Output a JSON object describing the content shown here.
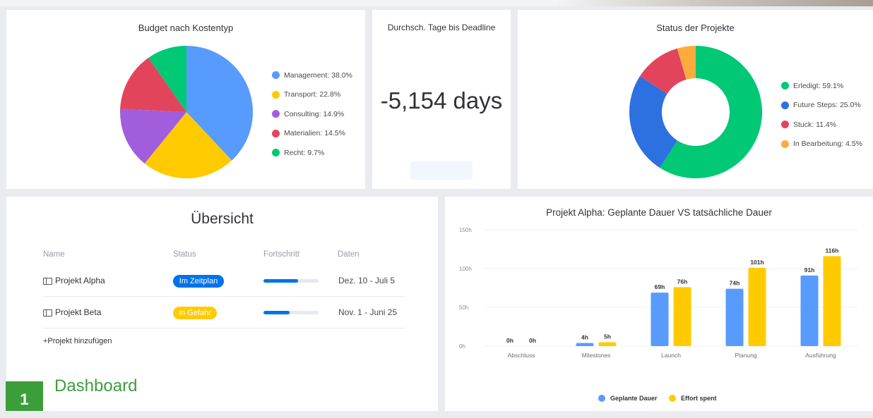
{
  "budget": {
    "title": "Budget nach Kostentyp",
    "legend": [
      {
        "label": "Management: 38.0%",
        "color": "#579bfc"
      },
      {
        "label": "Transport: 22.8%",
        "color": "#ffcb00"
      },
      {
        "label": "Consulting: 14.9%",
        "color": "#a25ddc"
      },
      {
        "label": "Materialien: 14.5%",
        "color": "#e2445c"
      },
      {
        "label": "Recht: 9.7%",
        "color": "#00c875"
      }
    ]
  },
  "deadline": {
    "title": "Durchsch. Tage bis Deadline",
    "value": "-5,154 days"
  },
  "status": {
    "title": "Status der Projekte",
    "legend": [
      {
        "label": "Erledigt: 59.1%",
        "color": "#00c875"
      },
      {
        "label": "Future Steps: 25.0%",
        "color": "#2d70e0"
      },
      {
        "label": "Stuck: 11.4%",
        "color": "#e2445c"
      },
      {
        "label": "In Bearbeitung: 4.5%",
        "color": "#fdab3d"
      }
    ]
  },
  "overview": {
    "title": "Übersicht",
    "columns": [
      "Name",
      "Status",
      "Fortschritt",
      "Daten"
    ],
    "rows": [
      {
        "name": "Projekt Alpha",
        "status": "Im Zeitplan",
        "status_color": "#0073ea",
        "progress": 0.63,
        "dates": "Dez. 10 - Juli 5"
      },
      {
        "name": "Projekt Beta",
        "status": "In Gefahr",
        "status_color": "#ffcb00",
        "progress": 0.47,
        "dates": "Nov. 1 - Juni 25"
      }
    ],
    "add_label": "+Projekt hinzufügen"
  },
  "chart_data": [
    {
      "type": "pie",
      "title": "Budget nach Kostentyp",
      "categories": [
        "Management",
        "Transport",
        "Consulting",
        "Materialien",
        "Recht"
      ],
      "values": [
        38.0,
        22.8,
        14.9,
        14.5,
        9.7
      ],
      "colors": [
        "#579bfc",
        "#ffcb00",
        "#a25ddc",
        "#e2445c",
        "#00c875"
      ]
    },
    {
      "type": "pie",
      "title": "Status der Projekte",
      "donut": true,
      "categories": [
        "Erledigt",
        "Future Steps",
        "Stuck",
        "In Bearbeitung"
      ],
      "values": [
        59.1,
        25.0,
        11.4,
        4.5
      ],
      "colors": [
        "#00c875",
        "#2d70e0",
        "#e2445c",
        "#fdab3d"
      ]
    },
    {
      "type": "bar",
      "title": "Projekt Alpha: Geplante Dauer VS tatsächliche Dauer",
      "categories": [
        "Abschluss",
        "Milestones",
        "Launch",
        "Planung",
        "Ausführung"
      ],
      "series": [
        {
          "name": "Geplante Dauer",
          "color": "#579bfc",
          "values": [
            0,
            4,
            69,
            74,
            91
          ],
          "labels": [
            "0h",
            "4h",
            "69h",
            "74h",
            "91h"
          ]
        },
        {
          "name": "Effort spent",
          "color": "#ffcb00",
          "values": [
            0,
            5,
            76,
            101,
            116
          ],
          "labels": [
            "0h",
            "5h",
            "76h",
            "101h",
            "116h"
          ]
        }
      ],
      "yticks": [
        "0h",
        "50h",
        "100h",
        "150h"
      ],
      "ylim": [
        0,
        150
      ],
      "grid": true,
      "legend_position": "bottom"
    }
  ],
  "step": {
    "number": "1",
    "label": "Dashboard"
  }
}
